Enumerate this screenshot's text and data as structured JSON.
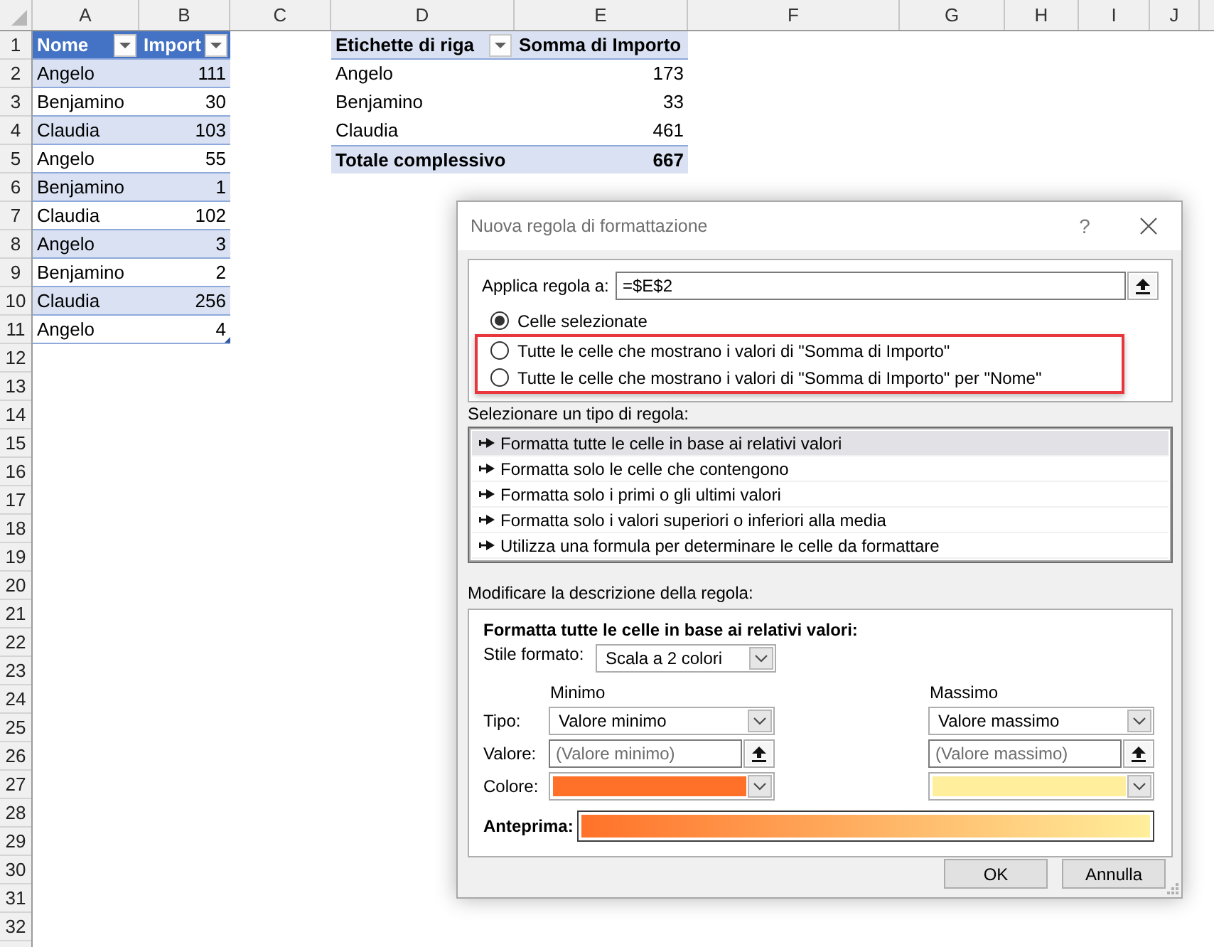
{
  "sheet": {
    "columns": [
      "A",
      "B",
      "C",
      "D",
      "E",
      "F",
      "G",
      "H",
      "I",
      "J"
    ],
    "rows": [
      "1",
      "2",
      "3",
      "4",
      "5",
      "6",
      "7",
      "8",
      "9",
      "10",
      "11",
      "12",
      "13",
      "14",
      "15",
      "16",
      "17",
      "18",
      "19",
      "20",
      "21",
      "22",
      "23",
      "24",
      "25",
      "26",
      "27",
      "28",
      "29",
      "30",
      "31",
      "32"
    ]
  },
  "table": {
    "columns": [
      {
        "label": "Nome",
        "filter": true
      },
      {
        "label": "Import",
        "filter": true
      }
    ],
    "rows": [
      [
        "Angelo",
        "111"
      ],
      [
        "Benjamino",
        "30"
      ],
      [
        "Claudia",
        "103"
      ],
      [
        "Angelo",
        "55"
      ],
      [
        "Benjamino",
        "1"
      ],
      [
        "Claudia",
        "102"
      ],
      [
        "Angelo",
        "3"
      ],
      [
        "Benjamino",
        "2"
      ],
      [
        "Claudia",
        "256"
      ],
      [
        "Angelo",
        "4"
      ]
    ]
  },
  "pivot": {
    "columns": [
      {
        "label": "Etichette di riga",
        "filter": true
      },
      {
        "label": "Somma di Importo",
        "filter": false
      }
    ],
    "rows": [
      [
        "Angelo",
        "173"
      ],
      [
        "Benjamino",
        "33"
      ],
      [
        "Claudia",
        "461"
      ]
    ],
    "total": [
      "Totale complessivo",
      "667"
    ]
  },
  "dialog": {
    "title": "Nuova regola di formattazione",
    "help": "?",
    "apply_to": {
      "label": "Applica regola a:",
      "value": "=$E$2"
    },
    "scope_options": [
      {
        "label": "Celle selezionate",
        "selected": true,
        "highlighted": false
      },
      {
        "label": "Tutte le celle che mostrano i valori di \"Somma di Importo\"",
        "selected": false,
        "highlighted": true
      },
      {
        "label": "Tutte le celle che mostrano i valori di \"Somma di Importo\" per \"Nome\"",
        "selected": false,
        "highlighted": true
      }
    ],
    "rule_type": {
      "label": "Selezionare un tipo di regola:",
      "items": [
        {
          "label": "Formatta tutte le celle in base ai relativi valori",
          "selected": true
        },
        {
          "label": "Formatta solo le celle che contengono",
          "selected": false
        },
        {
          "label": "Formatta solo i primi o gli ultimi valori",
          "selected": false
        },
        {
          "label": "Formatta solo i valori superiori o inferiori alla media",
          "selected": false
        },
        {
          "label": "Utilizza una formula per determinare le celle da formattare",
          "selected": false
        }
      ]
    },
    "description": {
      "label": "Modificare la descrizione della regola:",
      "heading": "Formatta tutte le celle in base ai relativi valori:",
      "format_style": {
        "label": "Stile formato:",
        "value": "Scala a 2 colori"
      },
      "row_labels": [
        "Tipo:",
        "Valore:",
        "Colore:"
      ],
      "ends": [
        {
          "heading": "Minimo",
          "type": "Valore minimo",
          "placeholder": "(Valore minimo)",
          "color": "#ff7128"
        },
        {
          "heading": "Massimo",
          "type": "Valore massimo",
          "placeholder": "(Valore massimo)",
          "color": "#ffef9c"
        }
      ],
      "preview_label": "Anteprima:"
    },
    "buttons": [
      {
        "label": "OK"
      },
      {
        "label": "Annulla"
      }
    ]
  }
}
